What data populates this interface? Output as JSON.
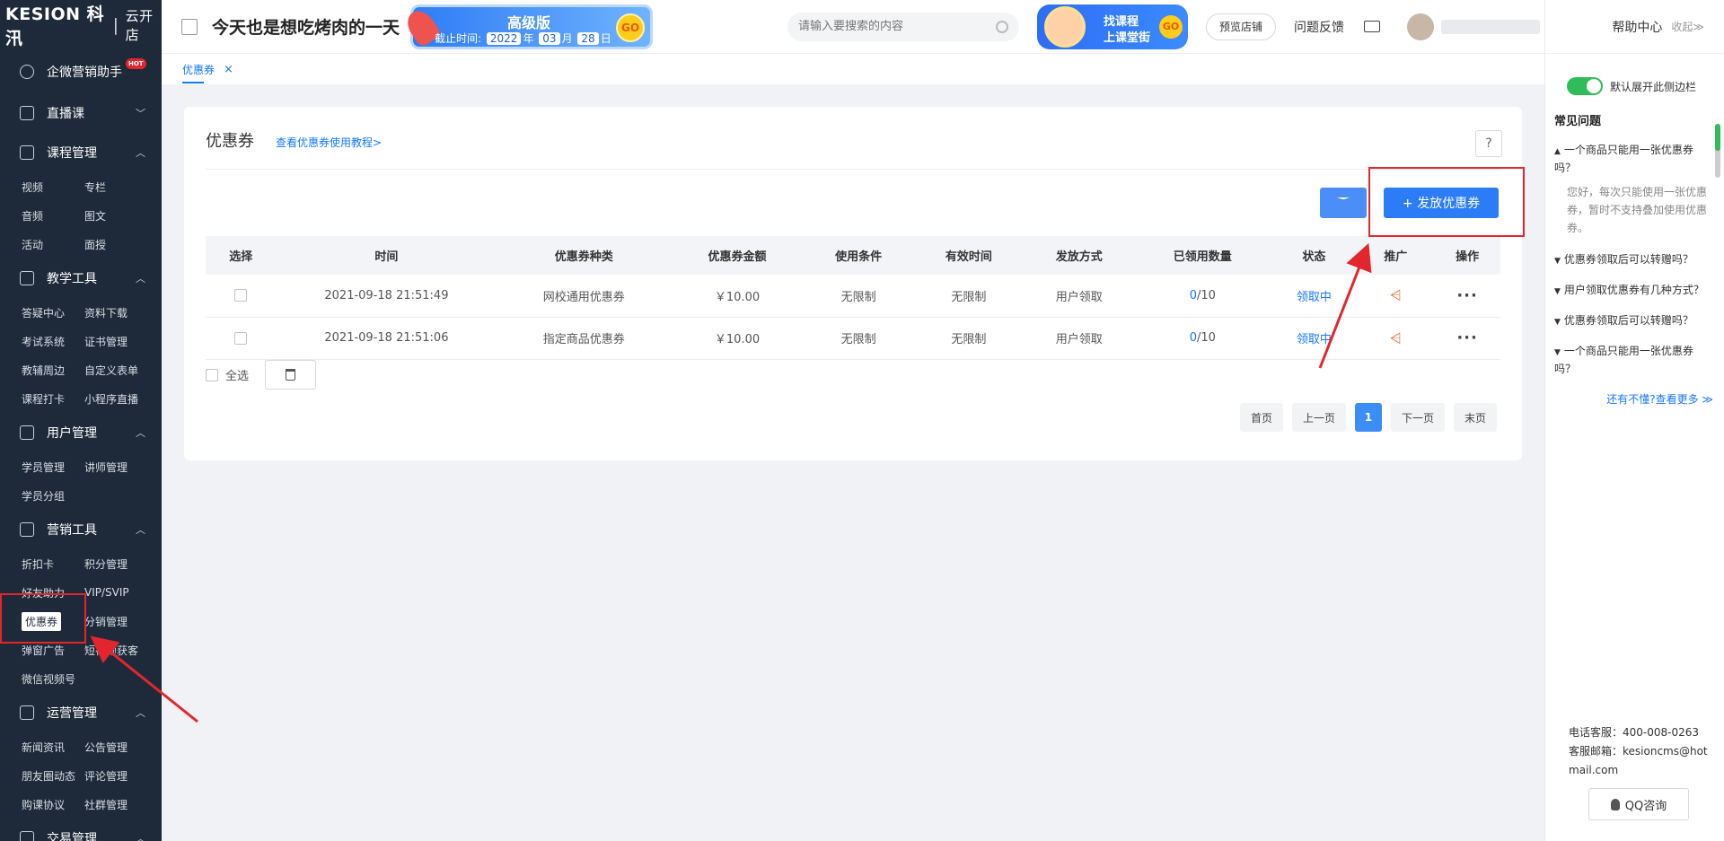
{
  "sidebar": {
    "logo_main": "KESION 科汛",
    "logo_sub": "云开店",
    "wecom": {
      "label": "企微营销助手",
      "badge": "HOT"
    },
    "groups": [
      {
        "label": "直播课",
        "chevron": "down",
        "items": []
      },
      {
        "label": "课程管理",
        "chevron": "up",
        "items": [
          "视频",
          "专栏",
          "音频",
          "图文",
          "活动",
          "面授"
        ]
      },
      {
        "label": "教学工具",
        "chevron": "up",
        "items": [
          "答疑中心",
          "资料下载",
          "考试系统",
          "证书管理",
          "教辅周边",
          "自定义表单",
          "课程打卡",
          "小程序直播"
        ]
      },
      {
        "label": "用户管理",
        "chevron": "up",
        "items": [
          "学员管理",
          "讲师管理",
          "学员分组"
        ]
      },
      {
        "label": "营销工具",
        "chevron": "up",
        "items": [
          "折扣卡",
          "积分管理",
          "好友助力",
          "VIP/SVIP",
          "优惠券",
          "分销管理",
          "弹窗广告",
          "短视频获客",
          "微信视频号"
        ]
      },
      {
        "label": "运营管理",
        "chevron": "up",
        "items": [
          "新闻资讯",
          "公告管理",
          "朋友圈动态",
          "评论管理",
          "购课协议",
          "社群管理"
        ]
      },
      {
        "label": "交易管理",
        "chevron": "up",
        "items": []
      }
    ],
    "active_item": "优惠券"
  },
  "header": {
    "site_title": "今天也是想吃烤肉的一天",
    "version": {
      "name": "高级版",
      "expire_label": "截止时间:",
      "year": "2022",
      "year_unit": "年",
      "month": "03",
      "month_unit": "月",
      "day": "28",
      "day_unit": "日",
      "go": "GO"
    },
    "search_placeholder": "请输入要搜索的内容",
    "course_banner": {
      "line1": "找课程",
      "line2": "上课堂街",
      "go": "GO"
    },
    "preview_label": "预览店铺",
    "feedback_label": "问题反馈"
  },
  "tabs": [
    {
      "label": "优惠券",
      "close": "×"
    }
  ],
  "main": {
    "title": "优惠券",
    "tutorial_link": "查看优惠券使用教程>",
    "help": "?",
    "issue_button": "+ 发放优惠券",
    "columns": [
      "选择",
      "时间",
      "优惠券种类",
      "优惠券金额",
      "使用条件",
      "有效时间",
      "发放方式",
      "已领用数量",
      "状态",
      "推广",
      "操作"
    ],
    "rows": [
      {
        "time": "2021-09-18 21:51:49",
        "type": "网校通用优惠券",
        "amount": "￥10.00",
        "condition": "无限制",
        "validity": "无限制",
        "method": "用户领取",
        "used": "0",
        "total": "/10",
        "status": "领取中",
        "more": "···"
      },
      {
        "time": "2021-09-18 21:51:06",
        "type": "指定商品优惠券",
        "amount": "￥10.00",
        "condition": "无限制",
        "validity": "无限制",
        "method": "用户领取",
        "used": "0",
        "total": "/10",
        "status": "领取中",
        "more": "···"
      }
    ],
    "select_all": "全选",
    "pager": {
      "first": "首页",
      "prev": "上一页",
      "current": "1",
      "next": "下一页",
      "last": "末页"
    }
  },
  "right_panel": {
    "title": "帮助中心",
    "collapse": "收起≫",
    "toggle_label": "默认展开此侧边栏",
    "faq_title": "常见问题",
    "faqs": [
      {
        "q": "一个商品只能用一张优惠券吗？",
        "open": true,
        "a": "您好，每次只能使用一张优惠券，暂时不支持叠加使用优惠券。"
      },
      {
        "q": "优惠券领取后可以转赠吗？",
        "open": false
      },
      {
        "q": "用户领取优惠券有几种方式？",
        "open": false
      },
      {
        "q": "优惠券领取后可以转赠吗？",
        "open": false
      },
      {
        "q": "一个商品只能用一张优惠券吗？",
        "open": false
      }
    ],
    "more_link": "还有不懂?查看更多 ≫",
    "phone": "电话客服：400-008-0263",
    "email": "客服邮箱：kesioncms@hotmail.com",
    "qq_button": "QQ咨询"
  },
  "colors": {
    "primary": "#2b7cf6",
    "sidebar_bg": "#1e2a3a",
    "annotation": "#e3262e",
    "toggle_on": "#2ebd59",
    "share": "#f36a3c"
  }
}
